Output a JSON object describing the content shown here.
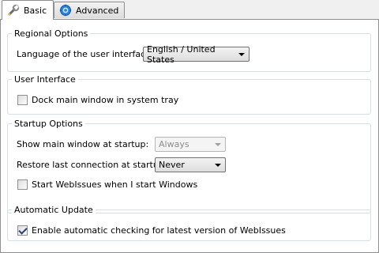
{
  "tabs": [
    {
      "label": "Basic",
      "icon": "wrench-icon",
      "active": true
    },
    {
      "label": "Advanced",
      "icon": "gear-icon",
      "active": false
    }
  ],
  "regional": {
    "title": "Regional Options",
    "language_label": "Language of the user interface:",
    "language_value": "English / United States"
  },
  "user_interface": {
    "title": "User Interface",
    "dock_label": "Dock main window in system tray",
    "dock_checked": false
  },
  "startup": {
    "title": "Startup Options",
    "show_label": "Show main window at startup:",
    "show_value": "Always",
    "show_disabled": true,
    "restore_label": "Restore last connection at startup:",
    "restore_value": "Never",
    "autostart_label": "Start WebIssues when I start Windows",
    "autostart_checked": false
  },
  "update": {
    "title": "Automatic Update",
    "check_label": "Enable automatic checking for latest version of WebIssues",
    "check_checked": true
  },
  "colors": {
    "group_border": "#d5dfe5",
    "check_mark": "#2c3d7a"
  }
}
